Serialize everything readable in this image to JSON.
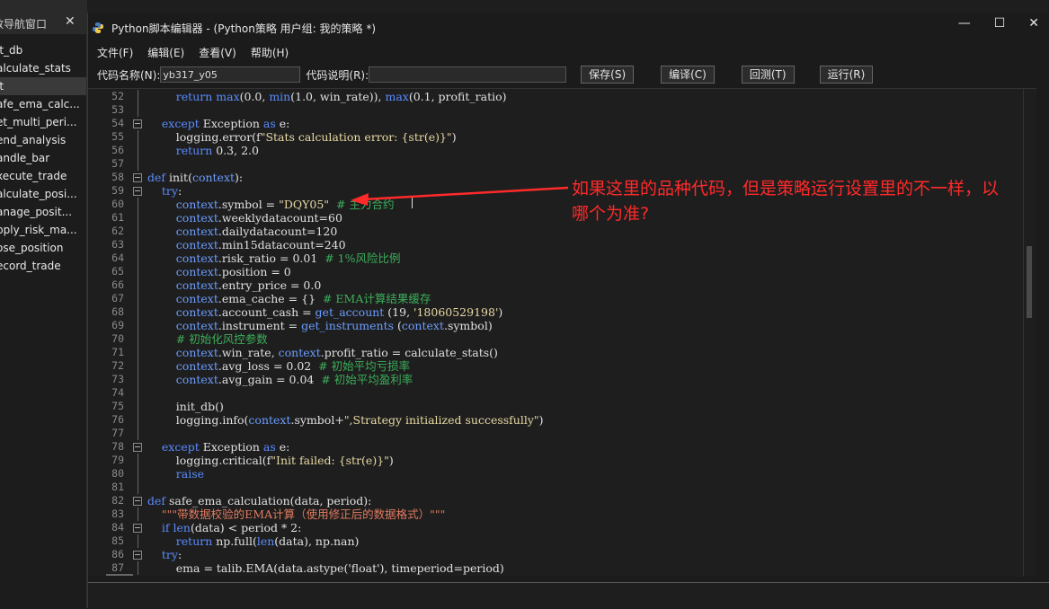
{
  "left_panel": {
    "title": "数导航窗口",
    "items": [
      "it_db",
      "alculate_stats",
      "it",
      "afe_ema_calc...",
      "et_multi_peri...",
      "end_analysis",
      "andle_bar",
      "xecute_trade",
      "alculate_posi...",
      "anage_posit...",
      "pply_risk_ma...",
      "ose_position",
      "ecord_trade"
    ],
    "selected_index": 2
  },
  "window": {
    "title": "Python脚本编辑器 - (Python策略 用户组: 我的策略 *)",
    "minimize": "—",
    "maximize": "☐",
    "close": "✕"
  },
  "menu": [
    "文件(F)",
    "编辑(E)",
    "查看(V)",
    "帮助(H)"
  ],
  "toolbar": {
    "code_name_label": "代码名称(N):",
    "code_name_value": "yb317_y05",
    "code_desc_label": "代码说明(R):",
    "code_desc_value": "",
    "save": "保存(S)",
    "compile": "编译(C)",
    "backtest": "回测(T)",
    "run": "运行(R)"
  },
  "code_lines": [
    {
      "n": "52",
      "html": "        <span class=\"kw\">return</span> <span class=\"kw\">max</span>(0.0, <span class=\"kw\">min</span>(1.0, win_rate)), <span class=\"kw\">max</span>(0.1, profit_ratio)"
    },
    {
      "n": "53",
      "html": ""
    },
    {
      "n": "54",
      "html": "    <span class=\"kw\">except</span> Exception <span class=\"kw\">as</span> e:",
      "fold": true
    },
    {
      "n": "55",
      "html": "        logging.error(f<span class=\"str\">\"Stats calculation error: {str(e)}\"</span>)"
    },
    {
      "n": "56",
      "html": "        <span class=\"kw\">return</span> 0.3, 2.0"
    },
    {
      "n": "57",
      "html": ""
    },
    {
      "n": "58",
      "html": "<span class=\"kw\">def</span> init(<span class=\"obj\">context</span>):",
      "fold": true
    },
    {
      "n": "59",
      "html": "    <span class=\"kw\">try</span>:",
      "fold": true
    },
    {
      "n": "60",
      "html": "        <span class=\"obj\">context</span>.symbol = <span class=\"str\">\"DQY05\"</span>  <span class=\"cm\"># 主力合约</span>"
    },
    {
      "n": "61",
      "html": "        <span class=\"obj\">context</span>.weeklydatacount=60"
    },
    {
      "n": "62",
      "html": "        <span class=\"obj\">context</span>.dailydatacount=120"
    },
    {
      "n": "63",
      "html": "        <span class=\"obj\">context</span>.min15datacount=240"
    },
    {
      "n": "64",
      "html": "        <span class=\"obj\">context</span>.risk_ratio = 0.01  <span class=\"cm\"># 1%风险比例</span>"
    },
    {
      "n": "65",
      "html": "        <span class=\"obj\">context</span>.position = 0"
    },
    {
      "n": "66",
      "html": "        <span class=\"obj\">context</span>.entry_price = 0.0"
    },
    {
      "n": "67",
      "html": "        <span class=\"obj\">context</span>.ema_cache = {}  <span class=\"cm\"># EMA计算结果缓存</span>"
    },
    {
      "n": "68",
      "html": "        <span class=\"obj\">context</span>.account_cash = <span class=\"obj\">get_account</span> (19, <span class=\"str\">'18060529198'</span>)"
    },
    {
      "n": "69",
      "html": "        <span class=\"obj\">context</span>.instrument = <span class=\"obj\">get_instruments</span> (<span class=\"obj\">context</span>.symbol)"
    },
    {
      "n": "70",
      "html": "        <span class=\"cm\"># 初始化风控参数</span>"
    },
    {
      "n": "71",
      "html": "        <span class=\"obj\">context</span>.win_rate, <span class=\"obj\">context</span>.profit_ratio = calculate_stats()"
    },
    {
      "n": "72",
      "html": "        <span class=\"obj\">context</span>.avg_loss = 0.02  <span class=\"cm\"># 初始平均亏损率</span>"
    },
    {
      "n": "73",
      "html": "        <span class=\"obj\">context</span>.avg_gain = 0.04  <span class=\"cm\"># 初始平均盈利率</span>"
    },
    {
      "n": "74",
      "html": ""
    },
    {
      "n": "75",
      "html": "        init_db()"
    },
    {
      "n": "76",
      "html": "        logging.info(<span class=\"obj\">context</span>.symbol+<span class=\"str\">\",Strategy initialized successfully\"</span>)"
    },
    {
      "n": "77",
      "html": ""
    },
    {
      "n": "78",
      "html": "    <span class=\"kw\">except</span> Exception <span class=\"kw\">as</span> e:",
      "fold": true
    },
    {
      "n": "79",
      "html": "        logging.critical(f<span class=\"str\">\"Init failed: {str(e)}\"</span>)"
    },
    {
      "n": "80",
      "html": "        <span class=\"kw\">raise</span>"
    },
    {
      "n": "81",
      "html": ""
    },
    {
      "n": "82",
      "html": "<span class=\"kw\">def</span> safe_ema_calculation(data, period):",
      "fold": true
    },
    {
      "n": "83",
      "html": "    <span class=\"cstr\">\"\"\"带数据校验的EMA计算（使用修正后的数据格式）\"\"\"</span>"
    },
    {
      "n": "84",
      "html": "    <span class=\"kw\">if</span> <span class=\"kw\">len</span>(data) &lt; period * 2:",
      "fold": true
    },
    {
      "n": "85",
      "html": "        <span class=\"kw\">return</span> np.full(<span class=\"kw\">len</span>(data), np.nan)"
    },
    {
      "n": "86",
      "html": "    <span class=\"kw\">try</span>:",
      "fold": true
    },
    {
      "n": "87",
      "html": "        ema = talib.EMA(data.astype('float'), timeperiod=period)"
    }
  ],
  "annotation": {
    "line1": "如果这里的品种代码，但是策略运行设置里的不一样，以",
    "line2": "哪个为准?"
  }
}
